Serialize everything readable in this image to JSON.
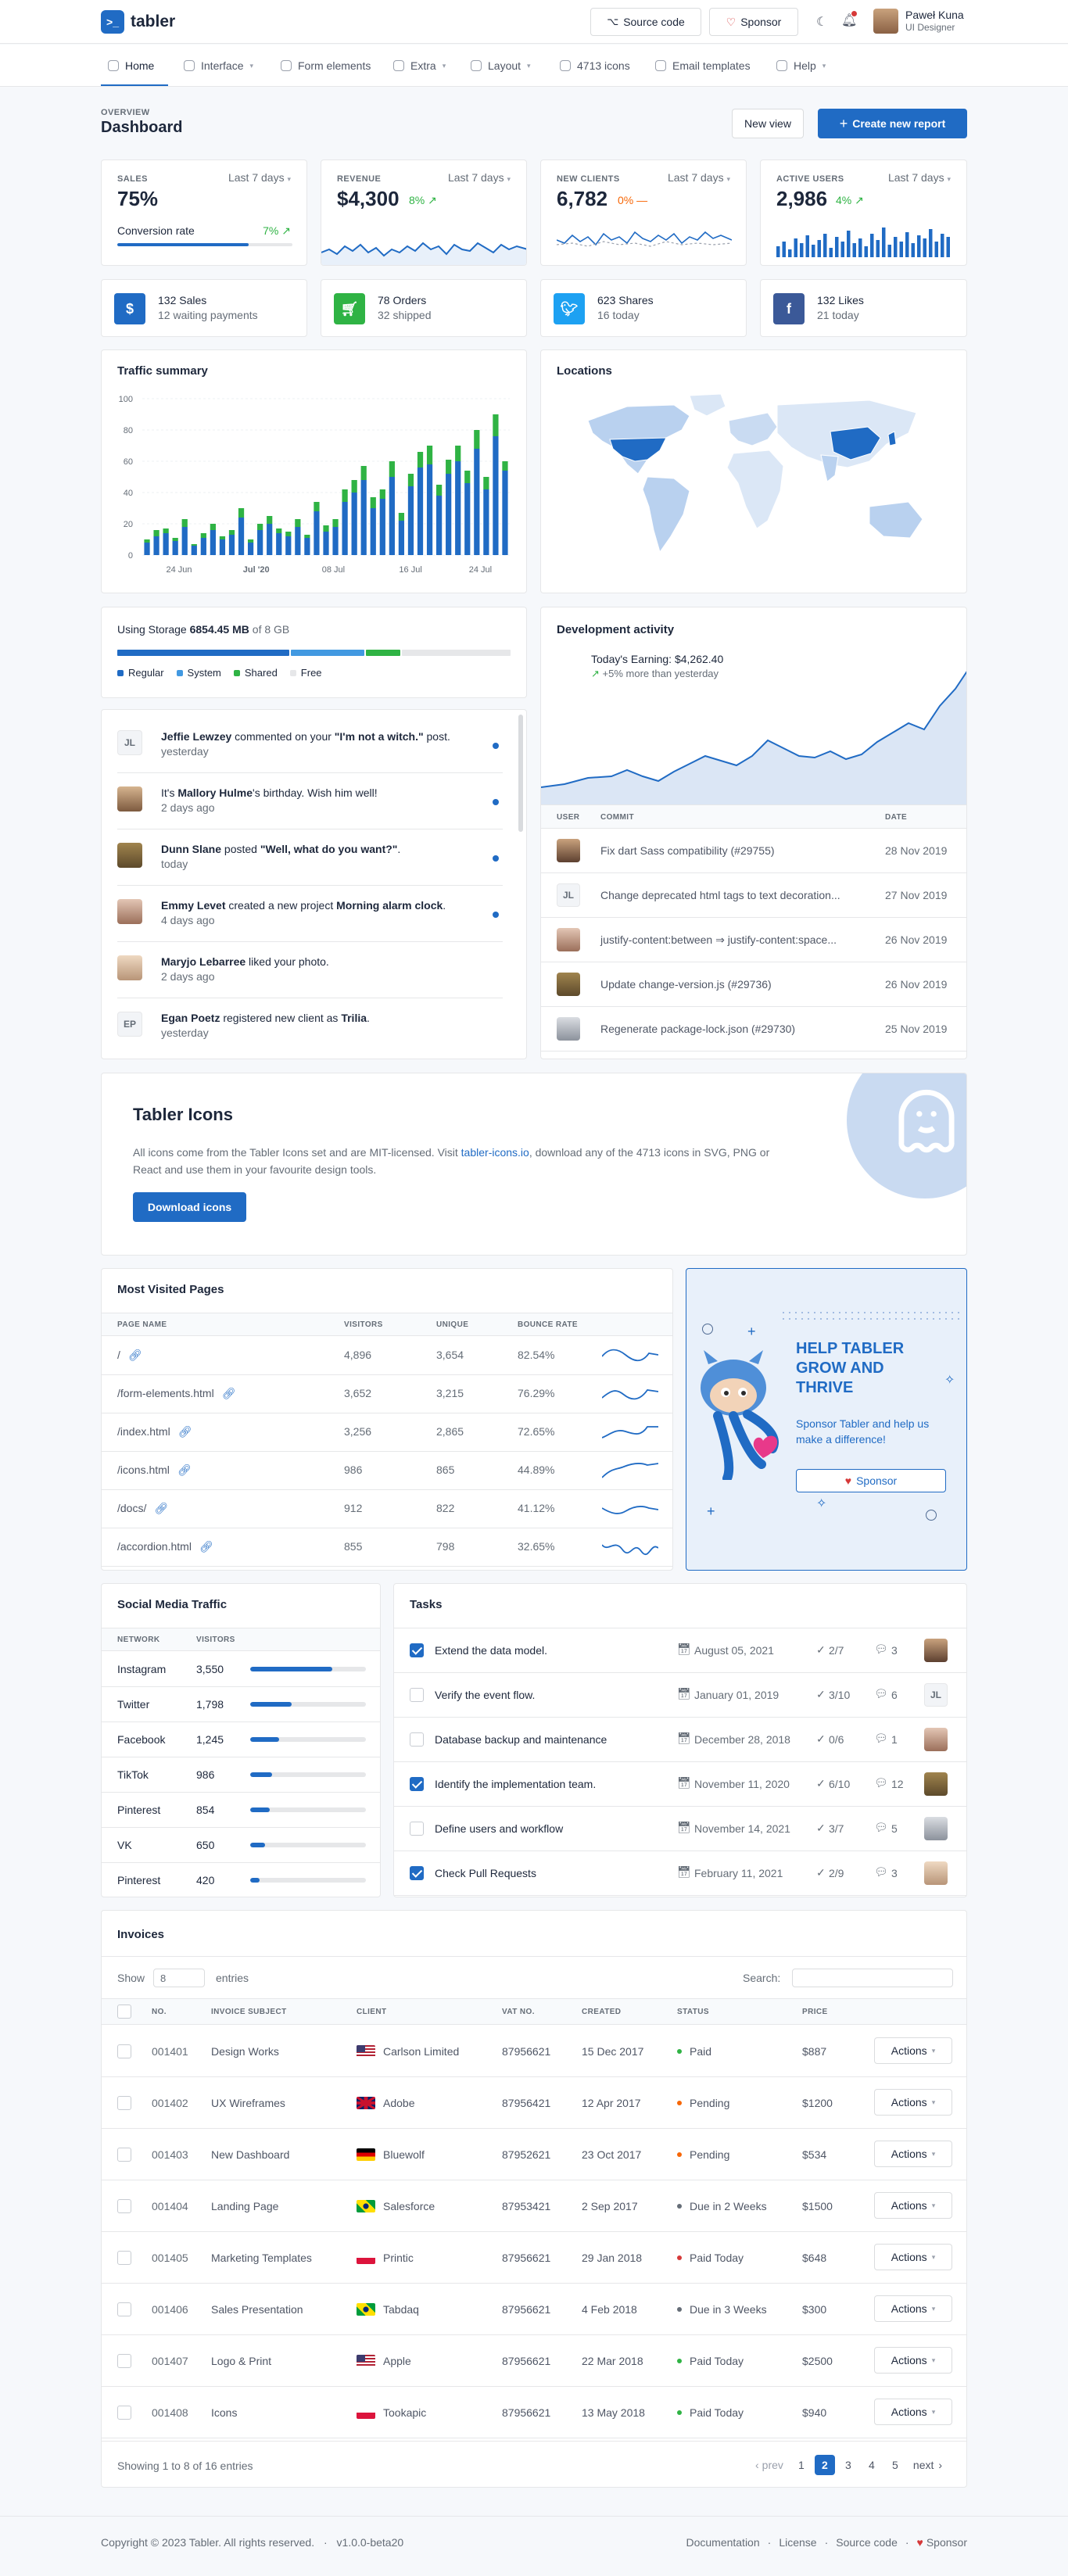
{
  "brand": {
    "name": "tabler"
  },
  "header": {
    "source_code": "Source code",
    "sponsor": "Sponsor",
    "user_name": "Paweł Kuna",
    "user_role": "UI Designer"
  },
  "nav": [
    {
      "label": "Home",
      "icon": "home-icon",
      "active": true
    },
    {
      "label": "Interface",
      "icon": "package-icon",
      "dropdown": true
    },
    {
      "label": "Form elements",
      "icon": "checkbox-icon"
    },
    {
      "label": "Extra",
      "icon": "star-icon",
      "dropdown": true
    },
    {
      "label": "Layout",
      "icon": "layout-icon",
      "dropdown": true
    },
    {
      "label": "4713 icons",
      "icon": "ghost-icon"
    },
    {
      "label": "Email templates",
      "icon": "mail-icon"
    },
    {
      "label": "Help",
      "icon": "lifebuoy-icon",
      "dropdown": true
    }
  ],
  "page": {
    "pretitle": "OVERVIEW",
    "title": "Dashboard",
    "new_view": "New view",
    "create_report": "Create new report"
  },
  "stats": {
    "period": "Last 7 days",
    "sales": {
      "label": "SALES",
      "value": "75%",
      "sub_label": "Conversion rate",
      "sub_value": "7%",
      "progress": 0.75
    },
    "revenue": {
      "label": "REVENUE",
      "value": "$4,300",
      "delta": "8%"
    },
    "new_clients": {
      "label": "NEW CLIENTS",
      "value": "6,782",
      "delta": "0%"
    },
    "active_users": {
      "label": "ACTIVE USERS",
      "value": "2,986",
      "delta": "4%"
    }
  },
  "mini_cards": [
    {
      "title": "132 Sales",
      "sub": "12 waiting payments",
      "icon": "currency-dollar-icon",
      "color": "#206bc4"
    },
    {
      "title": "78 Orders",
      "sub": "32 shipped",
      "icon": "shopping-cart-icon",
      "color": "#2fb344"
    },
    {
      "title": "623 Shares",
      "sub": "16 today",
      "icon": "twitter-icon",
      "color": "#1da1f2"
    },
    {
      "title": "132 Likes",
      "sub": "21 today",
      "icon": "facebook-icon",
      "color": "#3b5998"
    }
  ],
  "traffic": {
    "title": "Traffic summary",
    "chart_data": {
      "type": "bar",
      "stacked": true,
      "y_ticks": [
        "100",
        "80",
        "60",
        "40",
        "20",
        "0"
      ],
      "ylim": [
        0,
        100
      ],
      "x_ticks": [
        "24 Jun",
        "Jul '20",
        "08 Jul",
        "16 Jul",
        "24 Jul"
      ],
      "series": [
        {
          "values": [
            8,
            12,
            14,
            9,
            18,
            6,
            11,
            16,
            10,
            13,
            24,
            8,
            16,
            20,
            14,
            12,
            18,
            11,
            28,
            15,
            18,
            34,
            40,
            48,
            30,
            36,
            50,
            22,
            44,
            56,
            58,
            38,
            52,
            60,
            46,
            68,
            42,
            76,
            54
          ]
        },
        {
          "values": [
            2,
            4,
            3,
            2,
            5,
            1,
            3,
            4,
            2,
            3,
            6,
            2,
            4,
            5,
            3,
            3,
            5,
            2,
            6,
            4,
            5,
            8,
            8,
            9,
            7,
            6,
            10,
            5,
            8,
            10,
            12,
            7,
            9,
            10,
            8,
            12,
            8,
            14,
            6
          ]
        }
      ]
    }
  },
  "locations": {
    "title": "Locations"
  },
  "storage": {
    "label": "Using Storage",
    "used": "6854.45 MB",
    "total": "of 8 GB",
    "legend": [
      "Regular",
      "System",
      "Shared",
      "Free"
    ],
    "segments": [
      0.44,
      0.19,
      0.09,
      0.28
    ]
  },
  "activity": [
    {
      "initials": "JL",
      "name": "Jeffie Lewzey",
      "action": " commented on your ",
      "target": "\"I'm not a witch.\"",
      "after": " post.",
      "time": "yesterday"
    },
    {
      "initials": "",
      "name": "Mallory Hulme",
      "before": "It's ",
      "action": "'s birthday. Wish him well!",
      "target": "",
      "after": "",
      "time": "2 days ago"
    },
    {
      "initials": "",
      "name": "Dunn Slane",
      "action": " posted ",
      "target": "\"Well, what do you want?\"",
      "after": ".",
      "time": "today"
    },
    {
      "initials": "",
      "name": "Emmy Levet",
      "action": " created a new project ",
      "target": "Morning alarm clock",
      "after": ".",
      "time": "4 days ago"
    },
    {
      "initials": "",
      "name": "Maryjo Lebarree",
      "action": " liked your photo.",
      "target": "",
      "after": "",
      "time": "2 days ago"
    },
    {
      "initials": "EP",
      "name": "Egan Poetz",
      "action": " registered new client as ",
      "target": "Trilia",
      "after": ".",
      "time": "yesterday"
    }
  ],
  "dev": {
    "title": "Development activity",
    "earning": "Today's Earning: $4,262.40",
    "more": "+5% more than yesterday",
    "cols": [
      "USER",
      "COMMIT",
      "DATE"
    ],
    "rows": [
      {
        "commit": "Fix dart Sass compatibility (#29755)",
        "date": "28 Nov 2019"
      },
      {
        "commit": "Change deprecated html tags to text decoration...",
        "date": "27 Nov 2019",
        "initials": "JL"
      },
      {
        "commit": "justify-content:between ⇒ justify-content:space...",
        "date": "26 Nov 2019"
      },
      {
        "commit": "Update change-version.js (#29736)",
        "date": "26 Nov 2019"
      },
      {
        "commit": "Regenerate package-lock.json (#29730)",
        "date": "25 Nov 2019"
      }
    ]
  },
  "icons_banner": {
    "title": "Tabler Icons",
    "text1": "All icons come from the Tabler Icons set and are MIT-licensed. Visit ",
    "link": "tabler-icons.io",
    "text2": ", download any of the 4713 icons in SVG, PNG or React and use them in your favourite design tools.",
    "button": "Download icons"
  },
  "visited": {
    "title": "Most Visited Pages",
    "cols": [
      "PAGE NAME",
      "VISITORS",
      "UNIQUE",
      "BOUNCE RATE"
    ],
    "rows": [
      {
        "page": "/",
        "visitors": "4,896",
        "unique": "3,654",
        "bounce": "82.54%"
      },
      {
        "page": "/form-elements.html",
        "visitors": "3,652",
        "unique": "3,215",
        "bounce": "76.29%"
      },
      {
        "page": "/index.html",
        "visitors": "3,256",
        "unique": "2,865",
        "bounce": "72.65%"
      },
      {
        "page": "/icons.html",
        "visitors": "986",
        "unique": "865",
        "bounce": "44.89%"
      },
      {
        "page": "/docs/",
        "visitors": "912",
        "unique": "822",
        "bounce": "41.12%"
      },
      {
        "page": "/accordion.html",
        "visitors": "855",
        "unique": "798",
        "bounce": "32.65%"
      }
    ]
  },
  "sponsor_card": {
    "title": "HELP TABLER GROW AND THRIVE",
    "text": "Sponsor Tabler and help us make a difference!",
    "button": "Sponsor"
  },
  "social": {
    "title": "Social Media Traffic",
    "cols": [
      "NETWORK",
      "VISITORS"
    ],
    "rows": [
      {
        "network": "Instagram",
        "visitors": "3,550",
        "ratio": 0.71
      },
      {
        "network": "Twitter",
        "visitors": "1,798",
        "ratio": 0.36
      },
      {
        "network": "Facebook",
        "visitors": "1,245",
        "ratio": 0.25
      },
      {
        "network": "TikTok",
        "visitors": "986",
        "ratio": 0.19
      },
      {
        "network": "Pinterest",
        "visitors": "854",
        "ratio": 0.17
      },
      {
        "network": "VK",
        "visitors": "650",
        "ratio": 0.13
      },
      {
        "network": "Pinterest",
        "visitors": "420",
        "ratio": 0.08
      }
    ]
  },
  "tasks": {
    "title": "Tasks",
    "rows": [
      {
        "done": true,
        "text": "Extend the data model.",
        "date": "August 05, 2021",
        "checks": "2/7",
        "comments": "3"
      },
      {
        "done": false,
        "text": "Verify the event flow.",
        "date": "January 01, 2019",
        "checks": "3/10",
        "comments": "6",
        "initials": "JL"
      },
      {
        "done": false,
        "text": "Database backup and maintenance",
        "date": "December 28, 2018",
        "checks": "0/6",
        "comments": "1"
      },
      {
        "done": true,
        "text": "Identify the implementation team.",
        "date": "November 11, 2020",
        "checks": "6/10",
        "comments": "12"
      },
      {
        "done": false,
        "text": "Define users and workflow",
        "date": "November 14, 2021",
        "checks": "3/7",
        "comments": "5"
      },
      {
        "done": true,
        "text": "Check Pull Requests",
        "date": "February 11, 2021",
        "checks": "2/9",
        "comments": "3"
      }
    ]
  },
  "invoices": {
    "title": "Invoices",
    "show": "Show",
    "entries_value": "8",
    "entries": "entries",
    "search": "Search:",
    "cols": [
      "NO.",
      "INVOICE SUBJECT",
      "CLIENT",
      "VAT NO.",
      "CREATED",
      "STATUS",
      "PRICE"
    ],
    "actions": "Actions",
    "rows": [
      {
        "no": "001401",
        "subject": "Design Works",
        "flag": "us",
        "client": "Carlson Limited",
        "vat": "87956621",
        "created": "15 Dec 2017",
        "status": "Paid",
        "status_color": "#2fb344",
        "price": "$887"
      },
      {
        "no": "001402",
        "subject": "UX Wireframes",
        "flag": "gb",
        "client": "Adobe",
        "vat": "87956421",
        "created": "12 Apr 2017",
        "status": "Pending",
        "status_color": "#f76707",
        "price": "$1200"
      },
      {
        "no": "001403",
        "subject": "New Dashboard",
        "flag": "de",
        "client": "Bluewolf",
        "vat": "87952621",
        "created": "23 Oct 2017",
        "status": "Pending",
        "status_color": "#f76707",
        "price": "$534"
      },
      {
        "no": "001404",
        "subject": "Landing Page",
        "flag": "br",
        "client": "Salesforce",
        "vat": "87953421",
        "created": "2 Sep 2017",
        "status": "Due in 2 Weeks",
        "status_color": "#656d77",
        "price": "$1500"
      },
      {
        "no": "001405",
        "subject": "Marketing Templates",
        "flag": "pl",
        "client": "Printic",
        "vat": "87956621",
        "created": "29 Jan 2018",
        "status": "Paid Today",
        "status_color": "#d63939",
        "price": "$648"
      },
      {
        "no": "001406",
        "subject": "Sales Presentation",
        "flag": "br",
        "client": "Tabdaq",
        "vat": "87956621",
        "created": "4 Feb 2018",
        "status": "Due in 3 Weeks",
        "status_color": "#656d77",
        "price": "$300"
      },
      {
        "no": "001407",
        "subject": "Logo & Print",
        "flag": "us",
        "client": "Apple",
        "vat": "87956621",
        "created": "22 Mar 2018",
        "status": "Paid Today",
        "status_color": "#2fb344",
        "price": "$2500"
      },
      {
        "no": "001408",
        "subject": "Icons",
        "flag": "pl",
        "client": "Tookapic",
        "vat": "87956621",
        "created": "13 May 2018",
        "status": "Paid Today",
        "status_color": "#2fb344",
        "price": "$940"
      }
    ],
    "showing": "Showing 1 to 8 of 16 entries",
    "prev": "prev",
    "next": "next",
    "pages": [
      "1",
      "2",
      "3",
      "4",
      "5"
    ],
    "active_page": "2"
  },
  "footer": {
    "copyright": "Copyright © 2023 Tabler. All rights reserved.",
    "version": "v1.0.0-beta20",
    "links": [
      "Documentation",
      "License",
      "Source code",
      "Sponsor"
    ]
  }
}
